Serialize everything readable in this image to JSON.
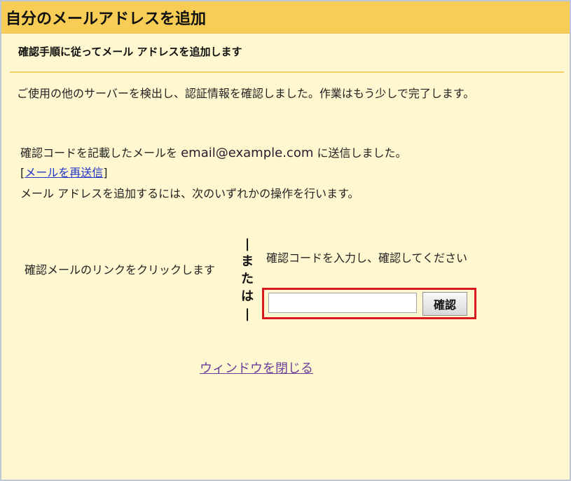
{
  "dialog": {
    "title": "自分のメールアドレスを追加",
    "subtitle": "確認手順に従ってメール アドレスを追加します",
    "intro": "ご使用の他のサーバーを検出し、認証情報を確認しました。作業はもう少しで完了します。",
    "sent_prefix": "確認コードを記載したメールを ",
    "email": "email@example.com",
    "sent_suffix": " に送信しました。",
    "resend_open": "[",
    "resend_label": "メールを再送信",
    "resend_close": "]",
    "instruction": "メール アドレスを追加するには、次のいずれかの操作を行います。",
    "left_option": "確認メールのリンクをクリックします",
    "or_text": "|\nま\nた\nは\n|",
    "right_option": "確認コードを入力し、確認してください",
    "code_input": {
      "value": "",
      "placeholder": ""
    },
    "confirm_label": "確認",
    "close_label": "ウィンドウを閉じる"
  }
}
